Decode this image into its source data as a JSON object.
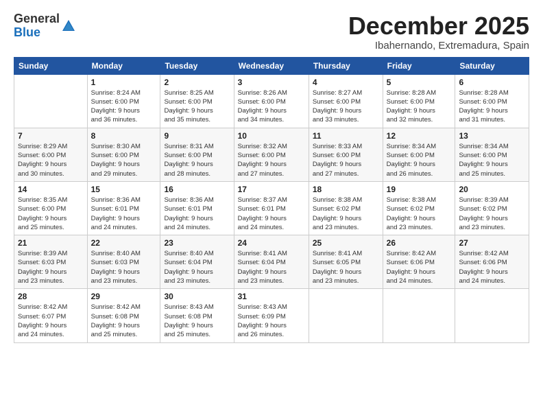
{
  "header": {
    "logo_general": "General",
    "logo_blue": "Blue",
    "month_title": "December 2025",
    "location": "Ibahernando, Extremadura, Spain"
  },
  "weekdays": [
    "Sunday",
    "Monday",
    "Tuesday",
    "Wednesday",
    "Thursday",
    "Friday",
    "Saturday"
  ],
  "weeks": [
    [
      {
        "day": "",
        "info": ""
      },
      {
        "day": "1",
        "info": "Sunrise: 8:24 AM\nSunset: 6:00 PM\nDaylight: 9 hours\nand 36 minutes."
      },
      {
        "day": "2",
        "info": "Sunrise: 8:25 AM\nSunset: 6:00 PM\nDaylight: 9 hours\nand 35 minutes."
      },
      {
        "day": "3",
        "info": "Sunrise: 8:26 AM\nSunset: 6:00 PM\nDaylight: 9 hours\nand 34 minutes."
      },
      {
        "day": "4",
        "info": "Sunrise: 8:27 AM\nSunset: 6:00 PM\nDaylight: 9 hours\nand 33 minutes."
      },
      {
        "day": "5",
        "info": "Sunrise: 8:28 AM\nSunset: 6:00 PM\nDaylight: 9 hours\nand 32 minutes."
      },
      {
        "day": "6",
        "info": "Sunrise: 8:28 AM\nSunset: 6:00 PM\nDaylight: 9 hours\nand 31 minutes."
      }
    ],
    [
      {
        "day": "7",
        "info": "Sunrise: 8:29 AM\nSunset: 6:00 PM\nDaylight: 9 hours\nand 30 minutes."
      },
      {
        "day": "8",
        "info": "Sunrise: 8:30 AM\nSunset: 6:00 PM\nDaylight: 9 hours\nand 29 minutes."
      },
      {
        "day": "9",
        "info": "Sunrise: 8:31 AM\nSunset: 6:00 PM\nDaylight: 9 hours\nand 28 minutes."
      },
      {
        "day": "10",
        "info": "Sunrise: 8:32 AM\nSunset: 6:00 PM\nDaylight: 9 hours\nand 27 minutes."
      },
      {
        "day": "11",
        "info": "Sunrise: 8:33 AM\nSunset: 6:00 PM\nDaylight: 9 hours\nand 27 minutes."
      },
      {
        "day": "12",
        "info": "Sunrise: 8:34 AM\nSunset: 6:00 PM\nDaylight: 9 hours\nand 26 minutes."
      },
      {
        "day": "13",
        "info": "Sunrise: 8:34 AM\nSunset: 6:00 PM\nDaylight: 9 hours\nand 25 minutes."
      }
    ],
    [
      {
        "day": "14",
        "info": "Sunrise: 8:35 AM\nSunset: 6:00 PM\nDaylight: 9 hours\nand 25 minutes."
      },
      {
        "day": "15",
        "info": "Sunrise: 8:36 AM\nSunset: 6:01 PM\nDaylight: 9 hours\nand 24 minutes."
      },
      {
        "day": "16",
        "info": "Sunrise: 8:36 AM\nSunset: 6:01 PM\nDaylight: 9 hours\nand 24 minutes."
      },
      {
        "day": "17",
        "info": "Sunrise: 8:37 AM\nSunset: 6:01 PM\nDaylight: 9 hours\nand 24 minutes."
      },
      {
        "day": "18",
        "info": "Sunrise: 8:38 AM\nSunset: 6:02 PM\nDaylight: 9 hours\nand 23 minutes."
      },
      {
        "day": "19",
        "info": "Sunrise: 8:38 AM\nSunset: 6:02 PM\nDaylight: 9 hours\nand 23 minutes."
      },
      {
        "day": "20",
        "info": "Sunrise: 8:39 AM\nSunset: 6:02 PM\nDaylight: 9 hours\nand 23 minutes."
      }
    ],
    [
      {
        "day": "21",
        "info": "Sunrise: 8:39 AM\nSunset: 6:03 PM\nDaylight: 9 hours\nand 23 minutes."
      },
      {
        "day": "22",
        "info": "Sunrise: 8:40 AM\nSunset: 6:03 PM\nDaylight: 9 hours\nand 23 minutes."
      },
      {
        "day": "23",
        "info": "Sunrise: 8:40 AM\nSunset: 6:04 PM\nDaylight: 9 hours\nand 23 minutes."
      },
      {
        "day": "24",
        "info": "Sunrise: 8:41 AM\nSunset: 6:04 PM\nDaylight: 9 hours\nand 23 minutes."
      },
      {
        "day": "25",
        "info": "Sunrise: 8:41 AM\nSunset: 6:05 PM\nDaylight: 9 hours\nand 23 minutes."
      },
      {
        "day": "26",
        "info": "Sunrise: 8:42 AM\nSunset: 6:06 PM\nDaylight: 9 hours\nand 24 minutes."
      },
      {
        "day": "27",
        "info": "Sunrise: 8:42 AM\nSunset: 6:06 PM\nDaylight: 9 hours\nand 24 minutes."
      }
    ],
    [
      {
        "day": "28",
        "info": "Sunrise: 8:42 AM\nSunset: 6:07 PM\nDaylight: 9 hours\nand 24 minutes."
      },
      {
        "day": "29",
        "info": "Sunrise: 8:42 AM\nSunset: 6:08 PM\nDaylight: 9 hours\nand 25 minutes."
      },
      {
        "day": "30",
        "info": "Sunrise: 8:43 AM\nSunset: 6:08 PM\nDaylight: 9 hours\nand 25 minutes."
      },
      {
        "day": "31",
        "info": "Sunrise: 8:43 AM\nSunset: 6:09 PM\nDaylight: 9 hours\nand 26 minutes."
      },
      {
        "day": "",
        "info": ""
      },
      {
        "day": "",
        "info": ""
      },
      {
        "day": "",
        "info": ""
      }
    ]
  ]
}
